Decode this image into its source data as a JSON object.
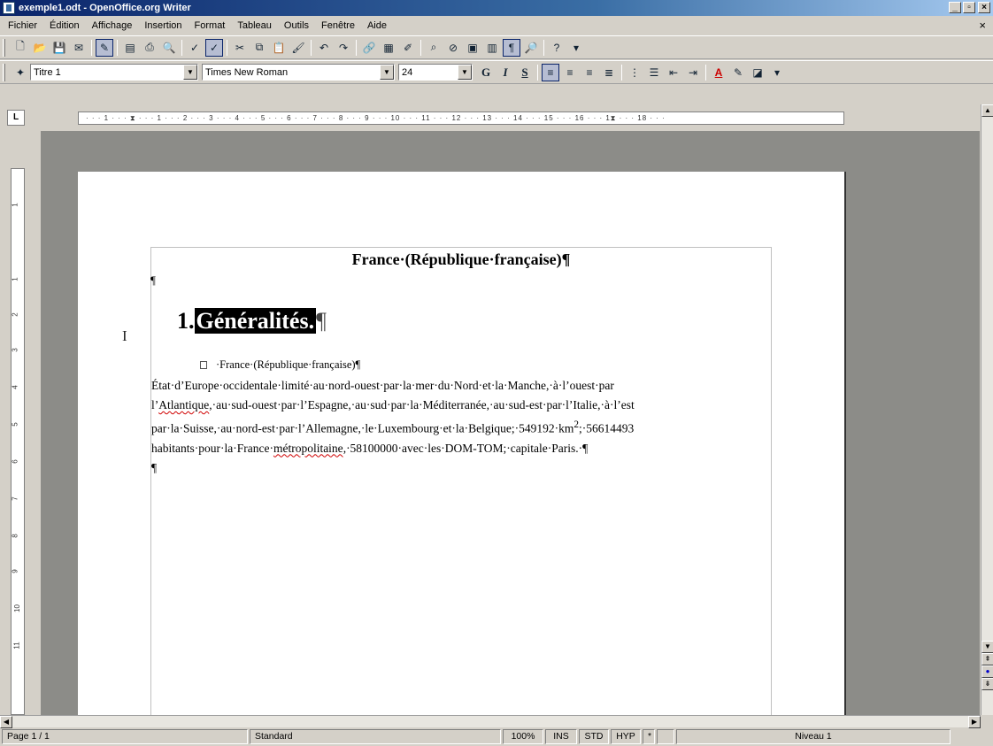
{
  "window": {
    "title": "exemple1.odt - OpenOffice.org Writer"
  },
  "menu": [
    "Fichier",
    "Édition",
    "Affichage",
    "Insertion",
    "Format",
    "Tableau",
    "Outils",
    "Fenêtre",
    "Aide"
  ],
  "format_bar": {
    "style": "Titre 1",
    "font": "Times New Roman",
    "size": "24",
    "bold": "G",
    "italic": "I",
    "underline": "S"
  },
  "ruler": {
    "marks": "· · · 1 · · · ⧗ · · · 1 · · · 2 · · · 3 · · · 4 · · · 5 · · · 6 · · · 7 · · · 8 · · · 9 · · · 10 · · · 11 · · · 12 · · · 13 · · · 14 · · · 15 · · · 16 · · · 1⧗ · · · 18 · · ·"
  },
  "vruler_numbers": [
    "1",
    "1",
    "2",
    "3",
    "4",
    "5",
    "6",
    "7",
    "8",
    "9",
    "10",
    "11"
  ],
  "document": {
    "title": "France·(République·française)¶",
    "empty_pilcrow": "¶",
    "heading_number": "1.",
    "heading_text": "Généralités.",
    "heading_pilcrow": "¶",
    "bullet_text": "·France·(République·française)¶",
    "line1": "État·d’Europe·occidentale·limité·au·nord-ouest·par·la·mer·du·Nord·et·la·Manche,·à·l’ouest·par",
    "line2_a": "l’",
    "line2_b": "Atlantique",
    "line2_c": ",·au·sud-ouest·par·l’Espagne,·au·sud·par·la·Méditerranée,·au·sud-est·par·l’Italie,·à·l’est",
    "line3_a": "par·la·Suisse,·au·nord-est·par·l’Allemagne,·le·Luxembourg·et·la·Belgique;·549192·km",
    "line3_sup": "2",
    "line3_b": ";·56614493",
    "line4_a": "habitants·pour·la·France·",
    "line4_b": "métropolitaine",
    "line4_c": ",·58100000·avec·les·DOM-TOM;·capitale·Paris.·¶",
    "end_pilcrow": "¶"
  },
  "status": {
    "page": "Page 1 / 1",
    "style": "Standard",
    "zoom": "100%",
    "ins": "INS",
    "std": "STD",
    "hyp": "HYP",
    "mod": "*",
    "level": "Niveau 1"
  }
}
